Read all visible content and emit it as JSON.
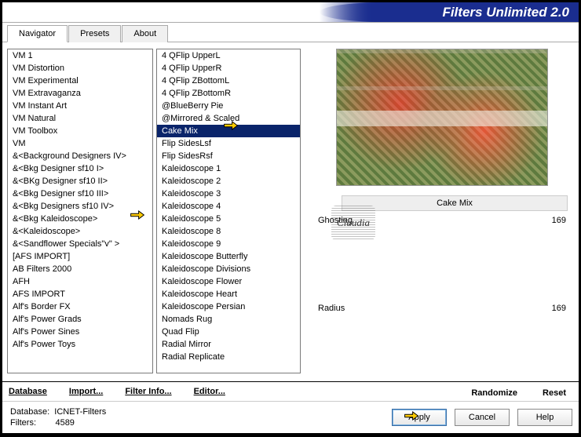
{
  "app_title": "Filters Unlimited 2.0",
  "tabs": [
    "Navigator",
    "Presets",
    "About"
  ],
  "active_tab": 0,
  "categories": [
    "VM 1",
    "VM Distortion",
    "VM Experimental",
    "VM Extravaganza",
    "VM Instant Art",
    "VM Natural",
    "VM Toolbox",
    "VM",
    "&<Background Designers IV>",
    "&<Bkg Designer sf10 I>",
    "&<BKg Designer sf10 II>",
    "&<Bkg Designer sf10 III>",
    "&<Bkg Designers sf10 IV>",
    "&<Bkg Kaleidoscope>",
    "&<Kaleidoscope>",
    "&<Sandflower Specials\"v\" >",
    "[AFS IMPORT]",
    "AB Filters 2000",
    "AFH",
    "AFS IMPORT",
    "Alf's Border FX",
    "Alf's Power Grads",
    "Alf's Power Sines",
    "Alf's Power Toys"
  ],
  "category_selected_index": 13,
  "filters": [
    "4 QFlip UpperL",
    "4 QFlip UpperR",
    "4 QFlip ZBottomL",
    "4 QFlip ZBottomR",
    "@BlueBerry Pie",
    "@Mirrored & Scaled",
    "Cake Mix",
    "Flip SidesLsf",
    "Flip SidesRsf",
    "Kaleidoscope 1",
    "Kaleidoscope 2",
    "Kaleidoscope 3",
    "Kaleidoscope 4",
    "Kaleidoscope 5",
    "Kaleidoscope 8",
    "Kaleidoscope 9",
    "Kaleidoscope Butterfly",
    "Kaleidoscope Divisions",
    "Kaleidoscope Flower",
    "Kaleidoscope Heart",
    "Kaleidoscope Persian",
    "Nomads Rug",
    "Quad Flip",
    "Radial Mirror",
    "Radial Replicate"
  ],
  "filter_selected_index": 6,
  "current_filter_name": "Cake Mix",
  "sliders": [
    {
      "label": "Ghosting",
      "value": "169"
    },
    {
      "label": "Radius",
      "value": "169"
    }
  ],
  "link_buttons": {
    "database": "Database",
    "import": "Import...",
    "filter_info": "Filter Info...",
    "editor": "Editor..."
  },
  "right_links": {
    "randomize": "Randomize",
    "reset": "Reset"
  },
  "footer": {
    "db_label": "Database:",
    "db_value": "ICNET-Filters",
    "filters_label": "Filters:",
    "filters_value": "4589"
  },
  "buttons": {
    "apply": "Apply",
    "cancel": "Cancel",
    "help": "Help"
  },
  "stamp": "Claudia"
}
